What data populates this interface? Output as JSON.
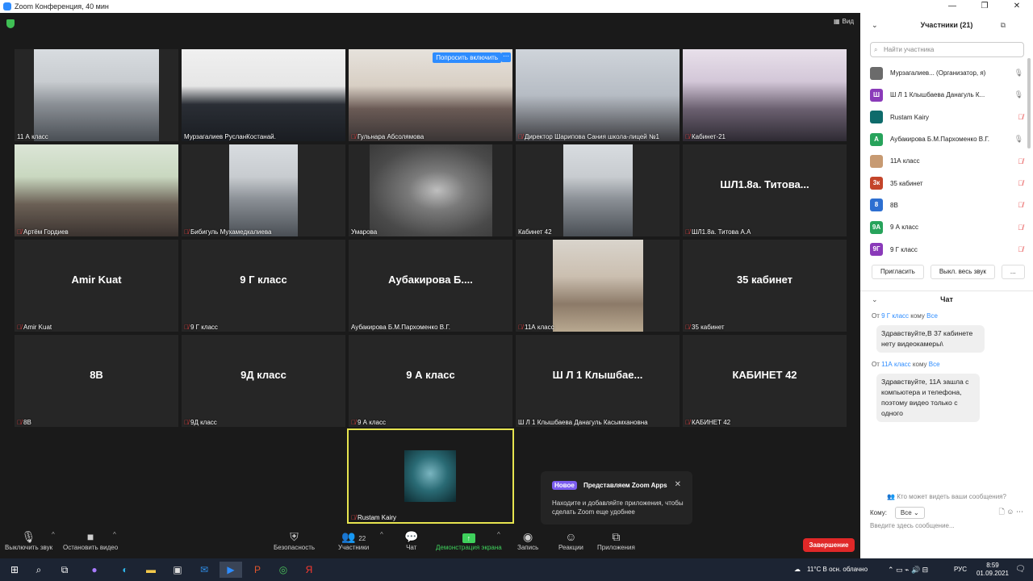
{
  "window": {
    "title": "Zoom Конференция, 40 мин",
    "buttons": [
      "—",
      "❐",
      "✕"
    ]
  },
  "top": {
    "view_label": "Вид"
  },
  "tiles": [
    {
      "name": "11 А класс",
      "muted": false,
      "video": "class1",
      "vx": 24,
      "vw": 155
    },
    {
      "name": "Мурзагалиев РусланКостанай.",
      "muted": false,
      "video": "person",
      "vx": 0,
      "vw": 203
    },
    {
      "name": "Гульнара Абсолямова",
      "muted": true,
      "video": "class2",
      "vx": 0,
      "vw": 203,
      "ask": "Попросить включить"
    },
    {
      "name": "Директор Шарипова Сания школа-лицей №1",
      "muted": true,
      "video": "office",
      "vx": 0,
      "vw": 203
    },
    {
      "name": "Кабинет-21",
      "muted": true,
      "video": "purple",
      "vx": 0,
      "vw": 203
    },
    {
      "name": "Артём Гордиев",
      "muted": true,
      "video": "green",
      "vx": 0,
      "vw": 203
    },
    {
      "name": "Бибигуль Мухамедкалиева",
      "muted": true,
      "video": "class1",
      "vx": 59,
      "vw": 85
    },
    {
      "name": "Умарова",
      "muted": false,
      "video": "dark",
      "vx": 26,
      "vw": 152
    },
    {
      "name": "Кабинет 42",
      "muted": false,
      "video": "class1",
      "vx": 59,
      "vw": 86
    },
    {
      "name": "ШЛ1.8а. Титова А.А",
      "muted": true,
      "big": "ШЛ1.8а.  Титова..."
    },
    {
      "name": "Amir Kuat",
      "muted": true,
      "big": "Amir Kuat"
    },
    {
      "name": "9 Г класс",
      "muted": true,
      "big": "9 Г класс"
    },
    {
      "name": "Аубакирова Б.М.Пархоменко В.Г.",
      "muted": false,
      "big": "Аубакирова  Б...."
    },
    {
      "name": "11А класс",
      "muted": true,
      "video": "woman",
      "vx": 46,
      "vw": 112
    },
    {
      "name": "35 кабинет",
      "muted": true,
      "big": "35 кабинет"
    },
    {
      "name": "8В",
      "muted": true,
      "big": "8В"
    },
    {
      "name": "9Д класс",
      "muted": true,
      "big": "9Д класс"
    },
    {
      "name": "9 А класс",
      "muted": true,
      "big": "9 А класс"
    },
    {
      "name": "Ш Л 1 Клышбаева Данагуль Касымхановна",
      "muted": false,
      "big": "Ш Л 1 Клышбае..."
    },
    {
      "name": "КАБИНЕТ 42",
      "muted": true,
      "big": "КАБИНЕТ 42"
    }
  ],
  "self_tile": {
    "name": "Rustam Kairy"
  },
  "popup": {
    "badge": "Новое",
    "title": "Представляем Zoom Apps",
    "text": "Находите и добавляйте приложения, чтобы сделать Zoom еще удобнее"
  },
  "toolbar": {
    "mute": "Выключить звук",
    "video": "Остановить видео",
    "security": "Безопасность",
    "participants": "Участники",
    "participants_count": "22",
    "chat": "Чат",
    "share": "Демонстрация экрана",
    "record": "Запись",
    "reactions": "Реакции",
    "apps": "Приложения",
    "end": "Завершение"
  },
  "panel": {
    "title": "Участники (21)",
    "search_placeholder": "Найти участника",
    "participants": [
      {
        "initials": "",
        "color": "#6b6b6b",
        "name": "Мурзагалиев... (Организатор, я)",
        "icon": "mic",
        "muted": false
      },
      {
        "initials": "Ш",
        "color": "#8a3ab9",
        "name": "Ш Л 1 Клышбаева Данагуль К...",
        "icon": "mic",
        "muted": false
      },
      {
        "initials": "",
        "color": "#0e6b6b",
        "name": "Rustam Kairy",
        "icon": "mic-off",
        "muted": true
      },
      {
        "initials": "А",
        "color": "#27a35b",
        "name": "Аубакирова Б.М.Пархоменко В.Г.",
        "icon": "mic",
        "muted": false
      },
      {
        "initials": "",
        "color": "#c79a72",
        "name": "11А класс",
        "icon": "mic-off",
        "muted": true
      },
      {
        "initials": "3к",
        "color": "#c4452a",
        "name": "35 кабинет",
        "icon": "mic-off",
        "muted": true
      },
      {
        "initials": "8",
        "color": "#2d6fd1",
        "name": "8В",
        "icon": "mic-off",
        "muted": true
      },
      {
        "initials": "9А",
        "color": "#27a35b",
        "name": "9 А класс",
        "icon": "mic-off",
        "muted": true
      },
      {
        "initials": "9Г",
        "color": "#8a3ab9",
        "name": "9 Г класс",
        "icon": "mic-off",
        "muted": true
      }
    ],
    "invite": "Пригласить",
    "mute_all": "Выкл. весь звук",
    "more": "...",
    "chat_title": "Чат",
    "messages": [
      {
        "from_pre": "От ",
        "from": "9 Г класс",
        "to_pre": " кому ",
        "to": "Все",
        "text": "Здравствуйте,В 37 кабинете нету видеокамеры\\"
      },
      {
        "from_pre": "От ",
        "from": "11А класс",
        "to_pre": " кому ",
        "to": "Все",
        "text": "Здравствуйте, 11А зашла с компьютера и телефона, поэтому видео только с одного"
      }
    ],
    "who_sees": "Кто может видеть ваши сообщения?",
    "to_label": "Кому:",
    "to_value": "Все",
    "input_placeholder": "Введите здесь сообщение..."
  },
  "taskbar": {
    "weather": "11°C  В осн. облачно",
    "lang": "РУС",
    "time": "8:59",
    "date": "01.09.2021"
  }
}
